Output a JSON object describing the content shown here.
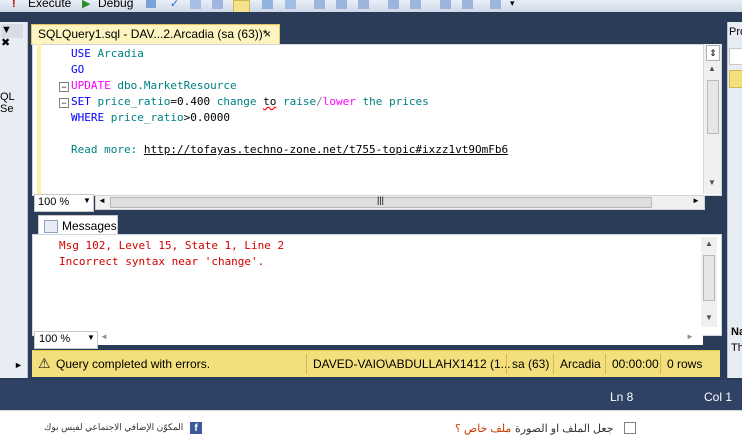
{
  "toolbar": {
    "execute_label": "Execute",
    "debug_label": "Debug"
  },
  "left_panel": {
    "pin_label": "‑✖",
    "label": "QL Se"
  },
  "right_panel": {
    "label": "Pro"
  },
  "document_tab": {
    "title": "SQLQuery1.sql - DAV...2.Arcadia (sa (63))*",
    "close_glyph": "×"
  },
  "editor": {
    "lines": [
      {
        "kw": "USE",
        "rest": "Arcadia"
      },
      {
        "kw": "GO",
        "rest": ""
      },
      {
        "pink": "UPDATE",
        "rest": "dbo.MarketResource"
      },
      {
        "kw": "SET",
        "a": "price_ratio",
        "b": "=0.400",
        "c": "change",
        "d": "to",
        "e": "raise",
        "f": "/",
        "g": "lower",
        "h": "the prices"
      },
      {
        "kw": "WHERE",
        "a": "price_ratio",
        "b": ">0.0000"
      },
      {
        "read_more": "Read more:",
        "url": "http://tofayas.techno-zone.net/t755-topic#ixzz1vt9OmFb6"
      }
    ],
    "zoom": "100 %"
  },
  "results": {
    "tab_label": "Messages",
    "messages": [
      "Msg 102, Level 15, State 1, Line 2",
      "Incorrect syntax near 'change'."
    ],
    "zoom": "100 %"
  },
  "status_bar": {
    "message": "Query completed with errors.",
    "server": "DAVED-VAIO\\ABDULLAHX1412 (1...",
    "user": "sa (63)",
    "database": "Arcadia",
    "elapsed": "00:00:00",
    "rows": "0 rows"
  },
  "ide_status": {
    "ln": "Ln 8",
    "col": "Col 1"
  },
  "browser": {
    "left_text": "المكوّن الإضافي الاجتماعي لفيس بوك",
    "right_text_prefix": "جعل الملف او الصورة",
    "right_text_link": "ملف خاص ؟",
    "accent": "#c83c00"
  },
  "right_edge": {
    "na": "Na",
    "th": "Th"
  }
}
